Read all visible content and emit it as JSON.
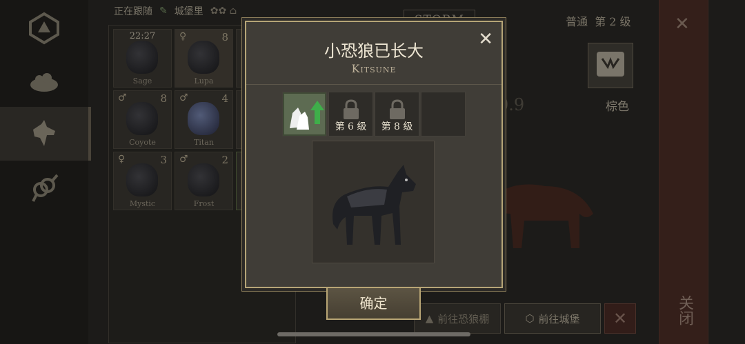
{
  "topbar": {
    "following_label": "正在跟随",
    "castle_label": "城堡里"
  },
  "grid": {
    "slots": [
      {
        "name": "Sage",
        "timer": "22:27",
        "sex": "",
        "level": ""
      },
      {
        "name": "Lupa",
        "timer": "",
        "sex": "♀",
        "level": "8"
      },
      {
        "name": "Coyote",
        "timer": "",
        "sex": "♂",
        "level": "8"
      },
      {
        "name": "Titan",
        "timer": "",
        "sex": "♂",
        "level": "4"
      },
      {
        "name": "Mystic",
        "timer": "",
        "sex": "♀",
        "level": "3"
      },
      {
        "name": "Frost",
        "timer": "",
        "sex": "♂",
        "level": "2"
      }
    ]
  },
  "right": {
    "storm_label": "STORM",
    "grade_text": "普通",
    "level_text": "第 2 级",
    "color_label": "棕色",
    "bg_number": "0.9",
    "go_kennel": "前往恐狼棚",
    "go_castle": "前往城堡",
    "side_close_label": "关闭"
  },
  "modal": {
    "title": "小恐狼已长大",
    "subtitle": "Kitsune",
    "stages": [
      {
        "label": "",
        "locked": false
      },
      {
        "label": "第 6 级",
        "locked": true
      },
      {
        "label": "第 8 级",
        "locked": true
      },
      {
        "label": "",
        "locked": false
      }
    ],
    "confirm_label": "确定"
  },
  "colors": {
    "accent_gold": "#b6a577",
    "close_red": "#4d2e27",
    "growth_green": "#3fae4a"
  }
}
